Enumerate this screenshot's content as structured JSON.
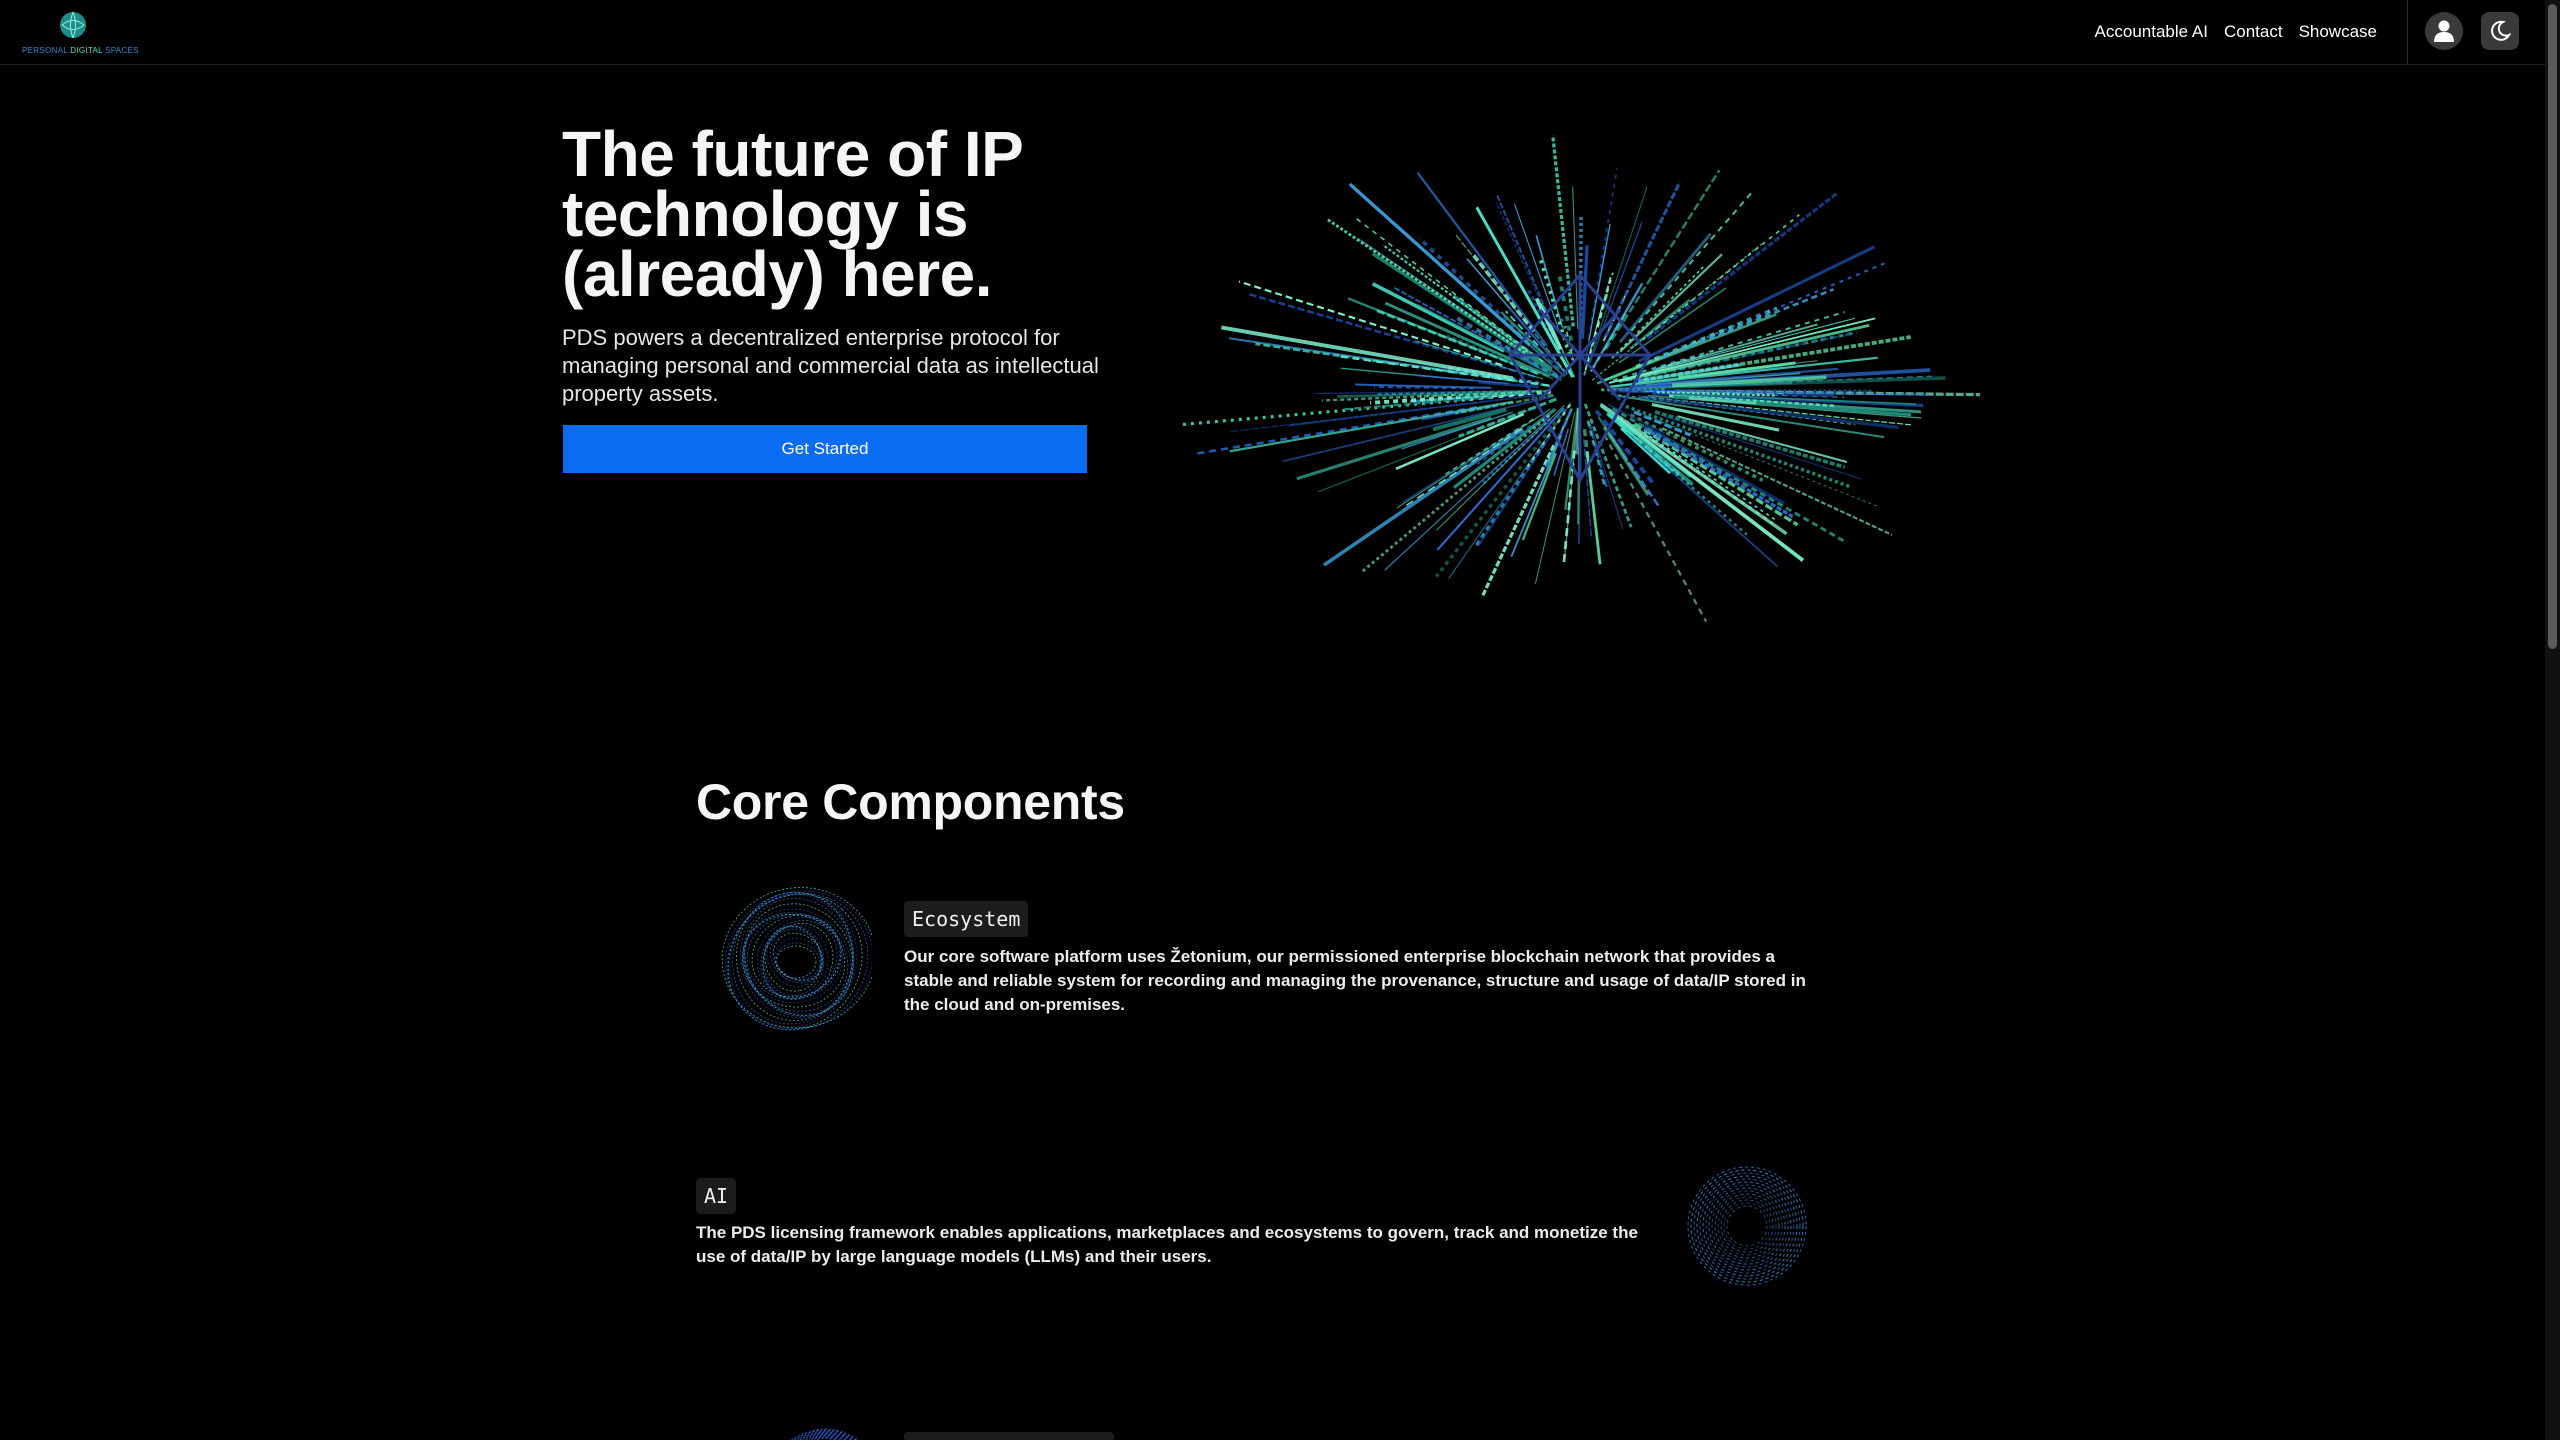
{
  "header": {
    "logo": {
      "word_1": "PERSONAL",
      "word_2": "DIGITAL",
      "word_3": "SPACES"
    },
    "nav": [
      {
        "label": "Accountable AI"
      },
      {
        "label": "Contact"
      },
      {
        "label": "Showcase"
      }
    ],
    "icons": {
      "account": "user-icon",
      "theme": "moon-icon"
    }
  },
  "hero": {
    "title": "The future of IP technology is (already) here.",
    "subtitle": "PDS powers a decentralized enterprise protocol for managing personal and commercial data as intellectual property assets.",
    "cta_label": "Get Started"
  },
  "core": {
    "title": "Core Components",
    "items": [
      {
        "tag": "Ecosystem",
        "description": "Our core software platform uses Žetonium, our permissioned enterprise blockchain network that provides a stable and reliable system for recording and managing the provenance, structure and usage of data/IP stored in the cloud and on-premises."
      },
      {
        "tag": "AI",
        "description": "The PDS licensing framework enables applications, marketplaces and ecosystems to govern, track and monetize the use of data/IP by large language models (LLMs) and their users."
      }
    ]
  },
  "colors": {
    "background": "#000000",
    "accent": "#0a6cf0",
    "teal": "#47e0c6",
    "blue": "#2d6fd6",
    "tag_bg": "#1c1c1c"
  }
}
